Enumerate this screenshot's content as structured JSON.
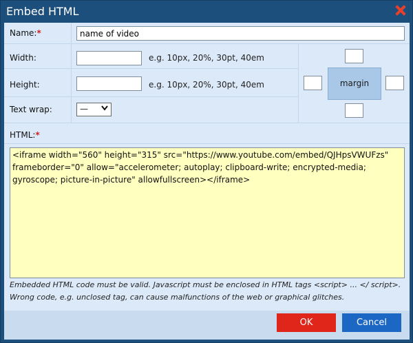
{
  "dialog": {
    "title": "Embed HTML"
  },
  "form": {
    "name_label": "Name:",
    "name_required": "*",
    "name_value": "name of video",
    "width_label": "Width:",
    "width_value": "",
    "width_hint": "e.g. 10px, 20%, 30pt, 40em",
    "height_label": "Height:",
    "height_value": "",
    "height_hint": "e.g. 10px, 20%, 30pt, 40em",
    "textwrap_label": "Text wrap:",
    "textwrap_selected": "—",
    "margin_label": "margin",
    "margin_top": "",
    "margin_left": "",
    "margin_right": "",
    "margin_bottom": "",
    "html_label": "HTML:",
    "html_required": "*",
    "html_value": "<iframe width=\"560\" height=\"315\" src=\"https://www.youtube.com/embed/QJHpsVWUFzs\" frameborder=\"0\" allow=\"accelerometer; autoplay; clipboard-write; encrypted-media; gyroscope; picture-in-picture\" allowfullscreen></iframe>",
    "note": "Embedded HTML code must be valid. Javascript must be enclosed in HTML tags <script> ... </ script>. Wrong code, e.g. unclosed tag, can cause malfunctions of the web or graphical glitches."
  },
  "buttons": {
    "ok": "OK",
    "cancel": "Cancel"
  }
}
